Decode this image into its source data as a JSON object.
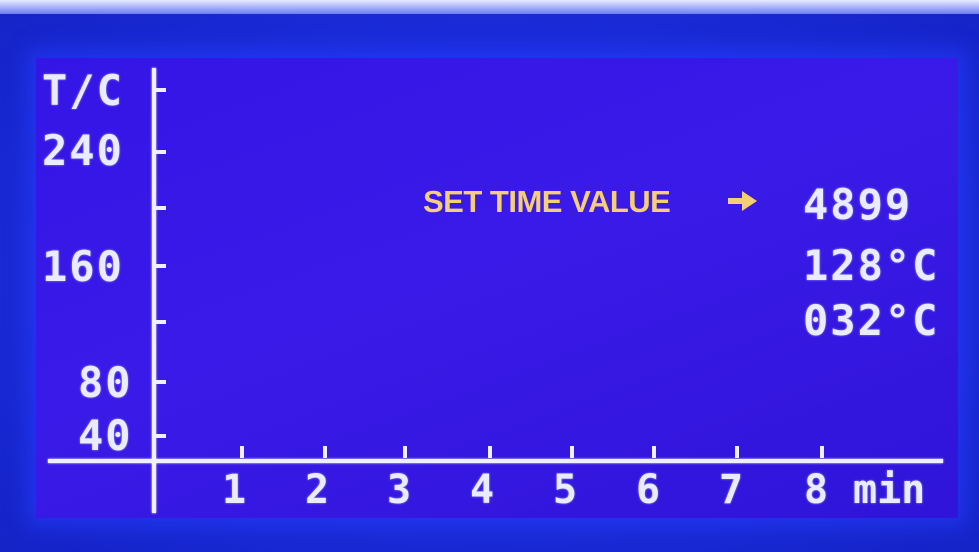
{
  "display": {
    "y_axis": {
      "unit_label": "T/C",
      "tick_labels": [
        "240",
        "160",
        "80",
        "40"
      ]
    },
    "x_axis": {
      "tick_labels": [
        "1",
        "2",
        "3",
        "4",
        "5",
        "6",
        "7",
        "8"
      ],
      "unit_label": "min"
    },
    "readings": {
      "time_value": "4899",
      "temperature_1": "128°C",
      "temperature_2": "032°C"
    }
  },
  "annotation": {
    "label": "SET TIME VALUE",
    "icon": "arrow-right-icon",
    "color": "#f5cf76"
  },
  "colors": {
    "screen_background": "#3415e6",
    "lcd_text": "#e9ecff",
    "bezel": "#1c2ddc"
  }
}
